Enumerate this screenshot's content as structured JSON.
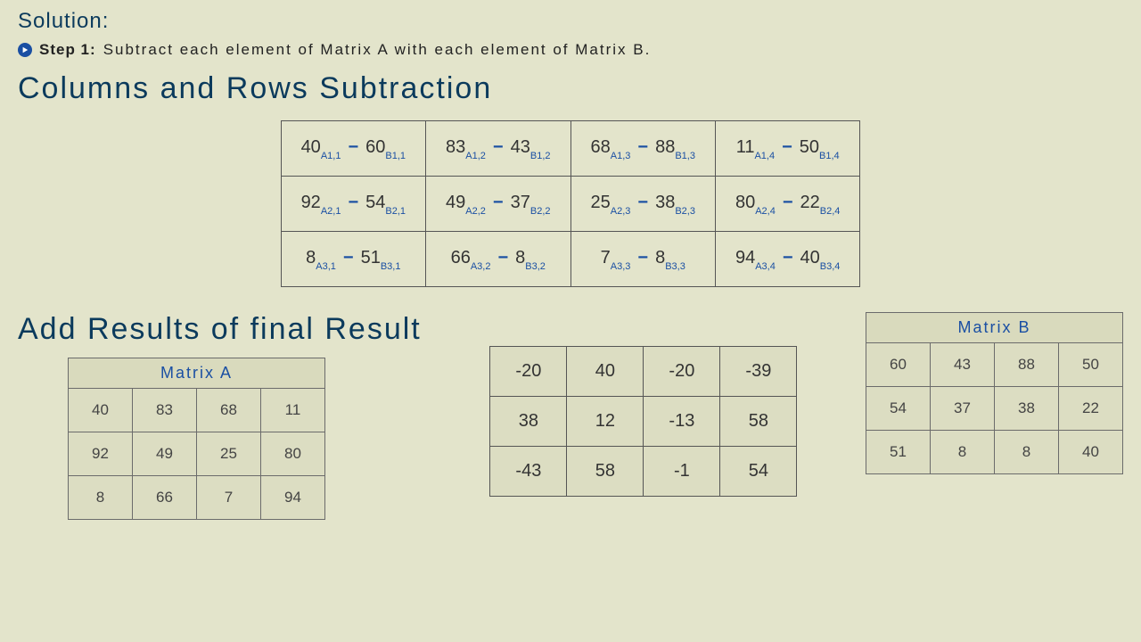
{
  "solution_label": "Solution:",
  "step": {
    "label": "Step 1:",
    "text": "Subtract each element of Matrix A with each element of Matrix B."
  },
  "heading_sub": "Columns and Rows Subtraction",
  "subtraction": {
    "rows": 3,
    "cols": 4,
    "cells": [
      [
        {
          "a": "40",
          "ai": "A1,1",
          "b": "60",
          "bi": "B1,1"
        },
        {
          "a": "83",
          "ai": "A1,2",
          "b": "43",
          "bi": "B1,2"
        },
        {
          "a": "68",
          "ai": "A1,3",
          "b": "88",
          "bi": "B1,3"
        },
        {
          "a": "11",
          "ai": "A1,4",
          "b": "50",
          "bi": "B1,4"
        }
      ],
      [
        {
          "a": "92",
          "ai": "A2,1",
          "b": "54",
          "bi": "B2,1"
        },
        {
          "a": "49",
          "ai": "A2,2",
          "b": "37",
          "bi": "B2,2"
        },
        {
          "a": "25",
          "ai": "A2,3",
          "b": "38",
          "bi": "B2,3"
        },
        {
          "a": "80",
          "ai": "A2,4",
          "b": "22",
          "bi": "B2,4"
        }
      ],
      [
        {
          "a": "8",
          "ai": "A3,1",
          "b": "51",
          "bi": "B3,1"
        },
        {
          "a": "66",
          "ai": "A3,2",
          "b": "8",
          "bi": "B3,2"
        },
        {
          "a": "7",
          "ai": "A3,3",
          "b": "8",
          "bi": "B3,3"
        },
        {
          "a": "94",
          "ai": "A3,4",
          "b": "40",
          "bi": "B3,4"
        }
      ]
    ]
  },
  "heading_results": "Add Results of final Result",
  "matrixA": {
    "title": "Matrix A",
    "rows": [
      [
        "40",
        "83",
        "68",
        "11"
      ],
      [
        "92",
        "49",
        "25",
        "80"
      ],
      [
        "8",
        "66",
        "7",
        "94"
      ]
    ]
  },
  "result": {
    "rows": [
      [
        "-20",
        "40",
        "-20",
        "-39"
      ],
      [
        "38",
        "12",
        "-13",
        "58"
      ],
      [
        "-43",
        "58",
        "-1",
        "54"
      ]
    ]
  },
  "matrixB": {
    "title": "Matrix B",
    "rows": [
      [
        "60",
        "43",
        "88",
        "50"
      ],
      [
        "54",
        "37",
        "38",
        "22"
      ],
      [
        "51",
        "8",
        "8",
        "40"
      ]
    ]
  },
  "colors": {
    "accent": "#1a4fa3",
    "heading": "#0b3a5c",
    "bg": "#e3e4cb"
  }
}
